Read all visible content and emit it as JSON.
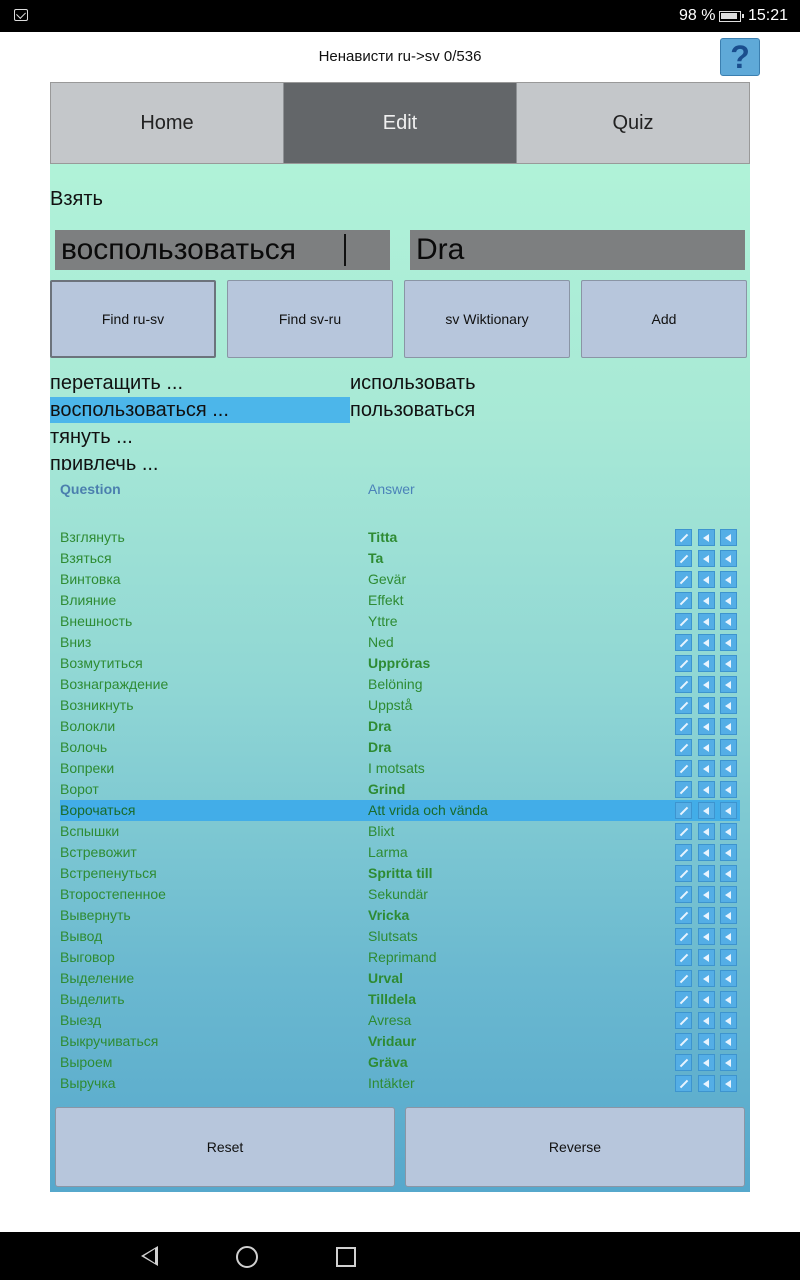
{
  "status_bar": {
    "battery_text": "98 %",
    "time": "15:21",
    "icons": "🎧 ≋"
  },
  "header": {
    "title": "Ненависти ru->sv 0/536",
    "help_label": "?"
  },
  "tabs": [
    "Home",
    "Edit",
    "Quiz"
  ],
  "editor": {
    "prompt": "Взять",
    "ru_value": "воспользоваться",
    "sv_value": "Dra"
  },
  "buttons": {
    "find_ru_sv": "Find ru-sv",
    "find_sv_ru": "Find sv-ru",
    "wiktionary": "sv Wiktionary",
    "add": "Add"
  },
  "suggestions": {
    "col1": [
      "перетащить ...",
      "воспользоваться ...",
      "тянуть ...",
      "привлечь ..."
    ],
    "col2": [
      "использовать",
      "пользоваться"
    ]
  },
  "list": {
    "header_question": "Question",
    "header_answer": "Answer",
    "rows": [
      {
        "q": "Взглянуть",
        "a": "Titta",
        "bold": true
      },
      {
        "q": "Взяться",
        "a": "Ta",
        "bold": true
      },
      {
        "q": "Винтовка",
        "a": "Gevär",
        "bold": false
      },
      {
        "q": "Влияние",
        "a": "Effekt",
        "bold": false
      },
      {
        "q": "Внешность",
        "a": "Yttre",
        "bold": false
      },
      {
        "q": "Вниз",
        "a": "Ned",
        "bold": false
      },
      {
        "q": "Возмутиться",
        "a": "Uppröras",
        "bold": true
      },
      {
        "q": "Вознаграждение",
        "a": "Belöning",
        "bold": false
      },
      {
        "q": "Возникнуть",
        "a": "Uppstå",
        "bold": false
      },
      {
        "q": "Волокли",
        "a": "Dra",
        "bold": true
      },
      {
        "q": "Волочь",
        "a": "Dra",
        "bold": true
      },
      {
        "q": "Вопреки",
        "a": "I motsats",
        "bold": false
      },
      {
        "q": "Ворот",
        "a": "Grind",
        "bold": true
      },
      {
        "q": "Ворочаться",
        "a": "Att vrida och vända",
        "bold": false,
        "selected": true
      },
      {
        "q": "Вспышки",
        "a": "Blixt",
        "bold": false
      },
      {
        "q": "Встревожит",
        "a": "Larma",
        "bold": false
      },
      {
        "q": "Встрепенуться",
        "a": "Spritta till",
        "bold": true
      },
      {
        "q": "Второстепенное",
        "a": "Sekundär",
        "bold": false
      },
      {
        "q": "Вывернуть",
        "a": "Vricka",
        "bold": true
      },
      {
        "q": "Вывод",
        "a": "Slutsats",
        "bold": false
      },
      {
        "q": "Выговор",
        "a": "Reprimand",
        "bold": false
      },
      {
        "q": "Выделение",
        "a": "Urval",
        "bold": true
      },
      {
        "q": "Выделить",
        "a": "Tilldela",
        "bold": true
      },
      {
        "q": "Выезд",
        "a": "Avresa",
        "bold": false
      },
      {
        "q": "Выкручиваться",
        "a": "Vridaur",
        "bold": true
      },
      {
        "q": "Выроем",
        "a": "Gräva",
        "bold": true
      },
      {
        "q": "Выручка",
        "a": "Intäkter",
        "bold": false
      }
    ]
  },
  "footer": {
    "reset": "Reset",
    "reverse": "Reverse"
  },
  "colors": {
    "accent": "#42ade8",
    "tab_active": "#636669",
    "answer_text": "#2e8b33"
  }
}
